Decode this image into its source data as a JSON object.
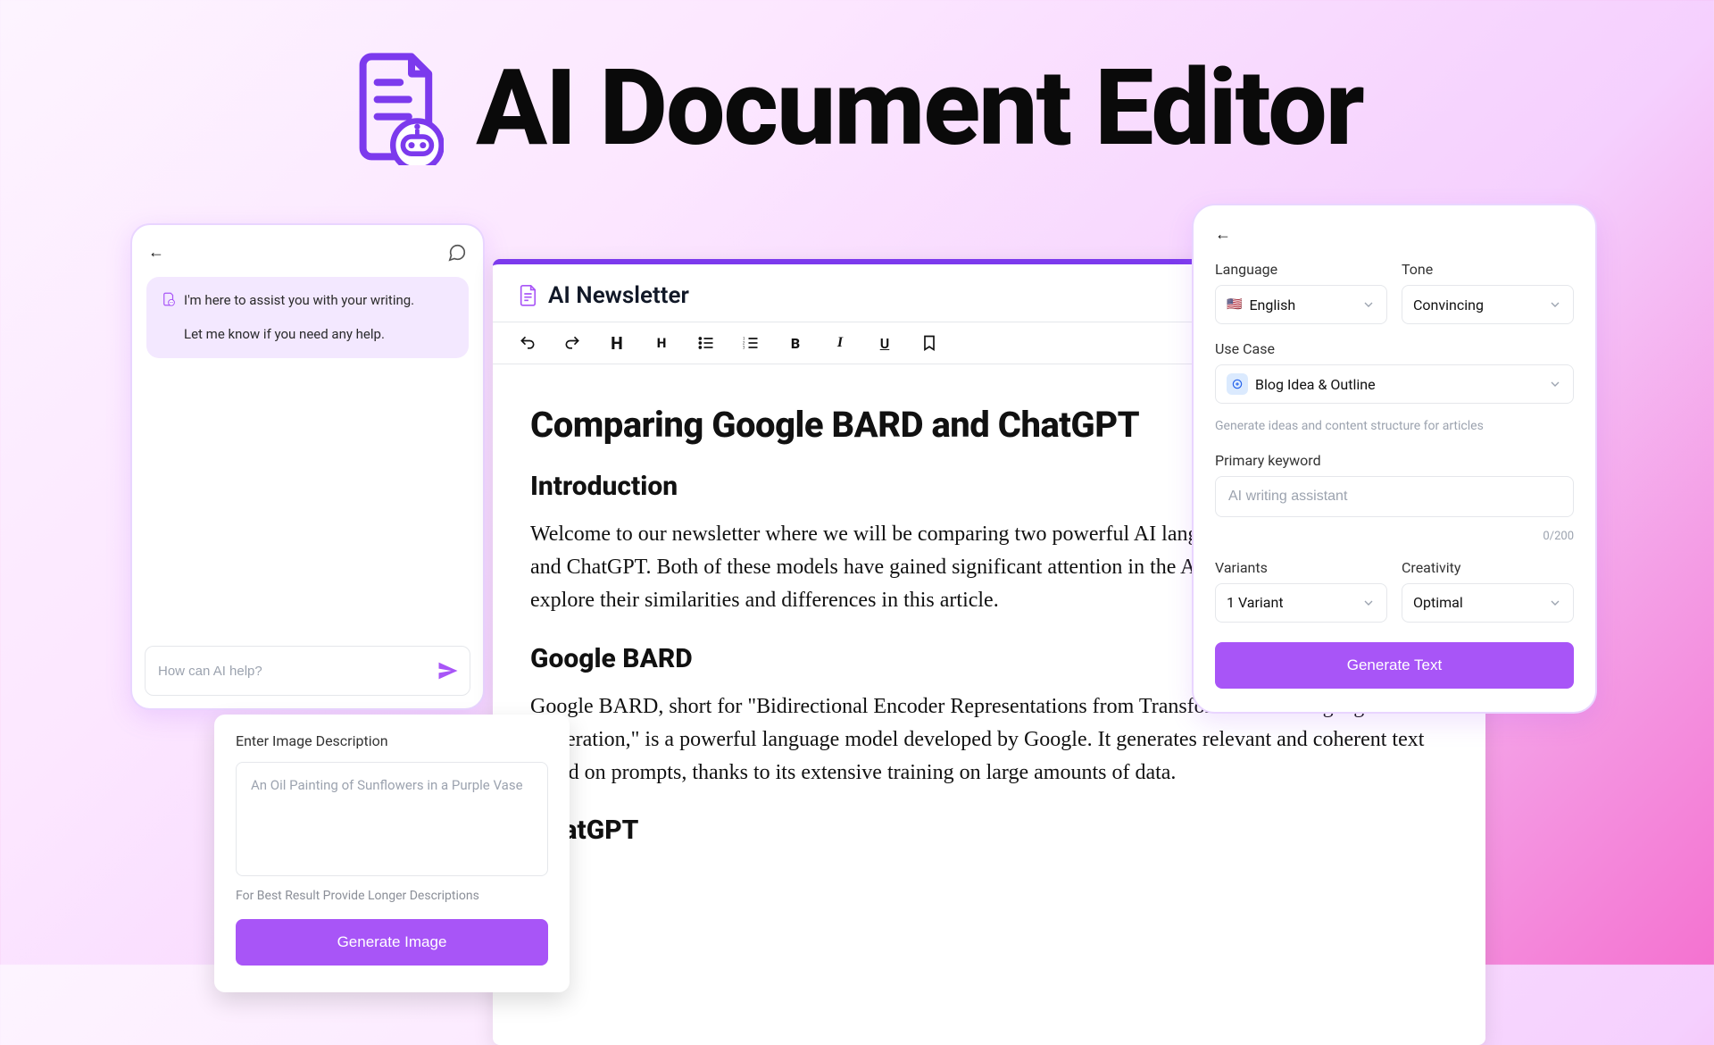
{
  "hero": {
    "title": "AI Document Editor"
  },
  "chat": {
    "line1": "I'm here to assist you with your writing.",
    "line2": "Let me know if you need any help.",
    "input_placeholder": "How can AI help?"
  },
  "doc": {
    "tab_title": "AI Newsletter",
    "h1": "Comparing Google BARD and ChatGPT",
    "sections": [
      {
        "heading": "Introduction",
        "body": "Welcome to our newsletter where we will be comparing two powerful AI language models: Google BARD and ChatGPT. Both of these models have gained significant attention in the AI community, and we will explore their similarities and differences in this article."
      },
      {
        "heading": "Google BARD",
        "body": "Google BARD, short for \"Bidirectional Encoder Representations from Transformers for Language Generation,\" is a powerful language model developed by Google. It generates relevant and coherent text based on prompts, thanks to its extensive training on large amounts of data."
      },
      {
        "heading": "ChatGPT",
        "body": ""
      }
    ]
  },
  "image_gen": {
    "label": "Enter Image Description",
    "placeholder": "An Oil Painting of Sunflowers in a Purple Vase",
    "hint": "For Best Result Provide Longer Descriptions",
    "button": "Generate Image"
  },
  "gen": {
    "language_label": "Language",
    "language_value": "English",
    "language_flag": "🇺🇸",
    "tone_label": "Tone",
    "tone_value": "Convincing",
    "usecase_label": "Use Case",
    "usecase_value": "Blog Idea & Outline",
    "usecase_hint": "Generate ideas and content structure for articles",
    "keyword_label": "Primary keyword",
    "keyword_placeholder": "AI writing assistant",
    "keyword_counter": "0/200",
    "variants_label": "Variants",
    "variants_value": "1 Variant",
    "creativity_label": "Creativity",
    "creativity_value": "Optimal",
    "button": "Generate Text"
  }
}
